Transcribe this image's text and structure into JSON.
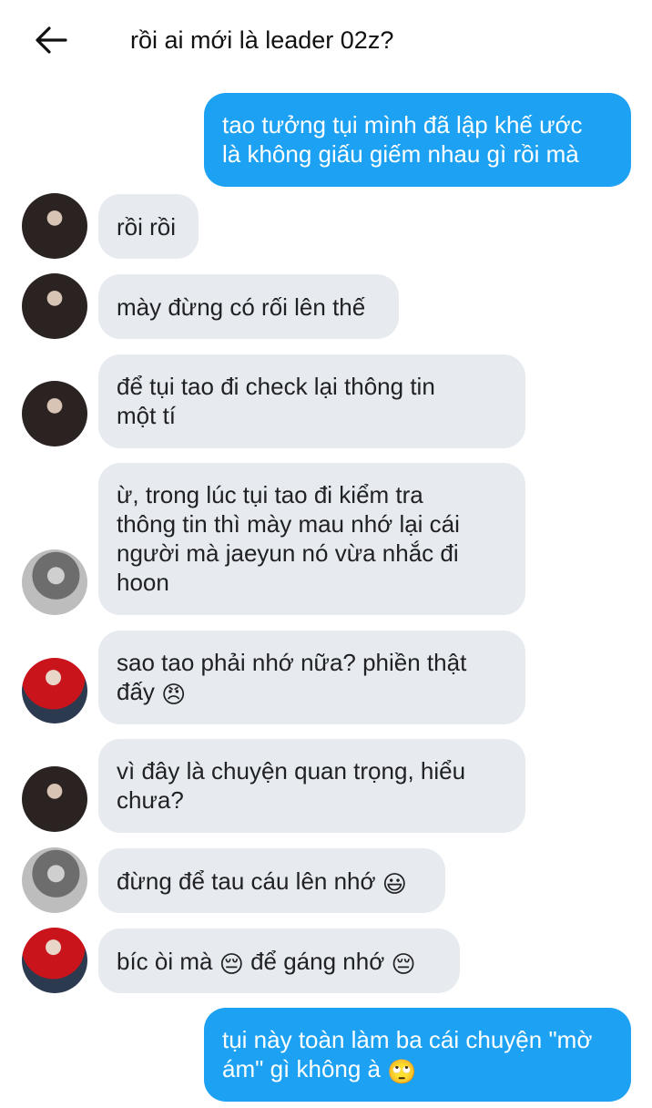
{
  "header": {
    "back_icon": "arrow-left-icon",
    "title": "rồi ai mới là leader 02z?"
  },
  "messages": [
    {
      "side": "out",
      "text_lines": [
        "tao tưởng tụi mình đã lập khế ước",
        "là không giấu giếm nhau gì rồi mà"
      ]
    },
    {
      "side": "in",
      "avatar": "avatar-dark-hair-person",
      "text": "rồi rồi"
    },
    {
      "side": "in",
      "avatar": "avatar-dark-hair-person",
      "text": "mày đừng có rối lên thế"
    },
    {
      "side": "in",
      "avatar": "avatar-dark-hair-person",
      "text_lines": [
        "để tụi tao đi check lại thông tin",
        "một tí"
      ]
    },
    {
      "side": "in",
      "avatar": "avatar-grayscale-person",
      "text_lines": [
        "ừ, trong lúc tụi tao đi kiểm tra",
        "thông tin thì mày mau nhớ lại cái",
        "người mà jaeyun nó vừa nhắc đi",
        "hoon"
      ]
    },
    {
      "side": "in",
      "avatar": "avatar-red-jacket-person",
      "text_lines": [
        "sao tao phải nhớ nữa? phiền thật",
        "đấy"
      ],
      "emoji": "😠"
    },
    {
      "side": "in",
      "avatar": "avatar-dark-hair-person",
      "text_lines": [
        "vì đây là chuyện quan trọng, hiểu",
        "chưa?"
      ]
    },
    {
      "side": "in",
      "avatar": "avatar-grayscale-person",
      "text": "đừng để tau cáu lên nhớ",
      "emoji": "😃"
    },
    {
      "side": "in",
      "avatar": "avatar-red-jacket-person",
      "text_a": "bíc òi mà",
      "emoji_a": "😔",
      "text_b": "để gáng nhớ",
      "emoji_b": "😔"
    },
    {
      "side": "out",
      "text_lines": [
        "tụi này toàn làm ba cái chuyện \"mờ",
        "ám\" gì không à"
      ],
      "emoji": "🙄"
    }
  ]
}
